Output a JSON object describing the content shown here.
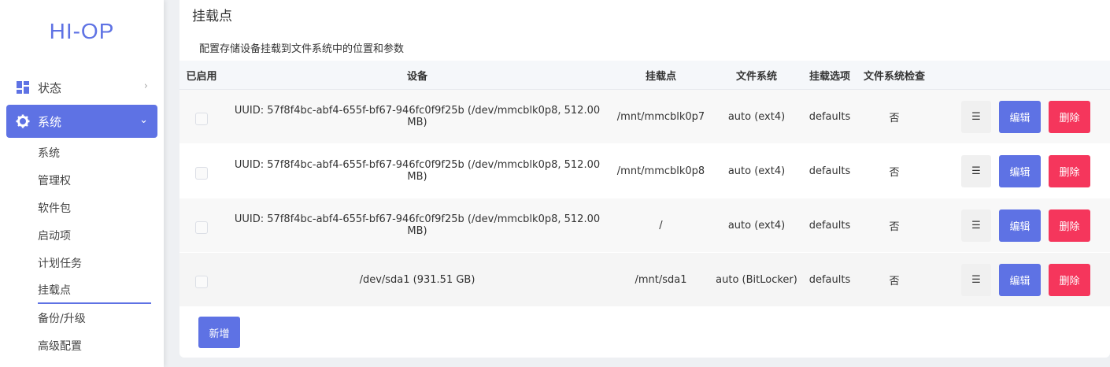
{
  "brand": "HI-OP",
  "sidebar": {
    "status_label": "状态",
    "system_label": "系统",
    "sub_items": [
      "系统",
      "管理权",
      "软件包",
      "启动项",
      "计划任务",
      "挂载点",
      "备份/升级",
      "高级配置"
    ],
    "active_sub": "挂载点"
  },
  "page": {
    "title": "挂载点",
    "description": "配置存储设备挂载到文件系统中的位置和参数"
  },
  "table": {
    "headers": {
      "enabled": "已启用",
      "device": "设备",
      "mountpoint": "挂载点",
      "filesystem": "文件系统",
      "options": "挂载选项",
      "fsck": "文件系统检查"
    },
    "rows": [
      {
        "device": "UUID: 57f8f4bc-abf4-655f-bf67-946fc0f9f25b (/dev/mmcblk0p8, 512.00 MB)",
        "mountpoint": "/mnt/mmcblk0p7",
        "filesystem": "auto (ext4)",
        "options": "defaults",
        "fsck": "否"
      },
      {
        "device": "UUID: 57f8f4bc-abf4-655f-bf67-946fc0f9f25b (/dev/mmcblk0p8, 512.00 MB)",
        "mountpoint": "/mnt/mmcblk0p8",
        "filesystem": "auto (ext4)",
        "options": "defaults",
        "fsck": "否"
      },
      {
        "device": "UUID: 57f8f4bc-abf4-655f-bf67-946fc0f9f25b (/dev/mmcblk0p8, 512.00 MB)",
        "mountpoint": "/",
        "filesystem": "auto (ext4)",
        "options": "defaults",
        "fsck": "否"
      },
      {
        "device": "/dev/sda1 (931.51 GB)",
        "mountpoint": "/mnt/sda1",
        "filesystem": "auto (BitLocker)",
        "options": "defaults",
        "fsck": "否"
      }
    ],
    "actions": {
      "menu": "☰",
      "edit": "编辑",
      "delete": "删除"
    }
  },
  "add_button": "新增",
  "colors": {
    "accent": "#5e72e4",
    "danger": "#f5365c"
  },
  "icons": {
    "status": "dashboard-icon",
    "system": "gear-icon"
  }
}
